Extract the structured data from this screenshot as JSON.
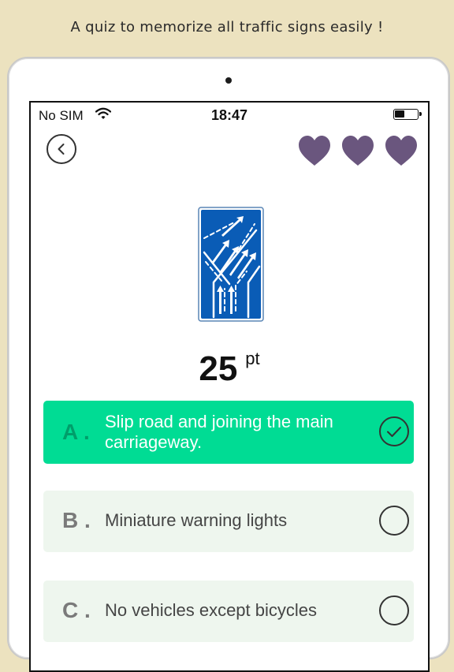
{
  "header": {
    "tagline": "A quiz to memorize all traffic signs easily !"
  },
  "status_bar": {
    "carrier": "No SIM",
    "time": "18:47",
    "battery_level": 0.45
  },
  "nav": {
    "back_icon": "chevron-left-icon"
  },
  "lives": {
    "count": 3,
    "icon": "heart-icon",
    "color": "#6a567e"
  },
  "question": {
    "sign_icon": "slip-road-joining-carriageway-sign",
    "sign_color": "#0a5cb6"
  },
  "score": {
    "points": "25",
    "unit": "pt"
  },
  "options": [
    {
      "letter": "A .",
      "text": "Slip road and joining the main carriageway.",
      "state": "correct",
      "color": "#00dc94"
    },
    {
      "letter": "B .",
      "text": "Miniature warning lights",
      "state": "unselected"
    },
    {
      "letter": "C .",
      "text": "No vehicles except bicycles",
      "state": "unselected"
    }
  ]
}
